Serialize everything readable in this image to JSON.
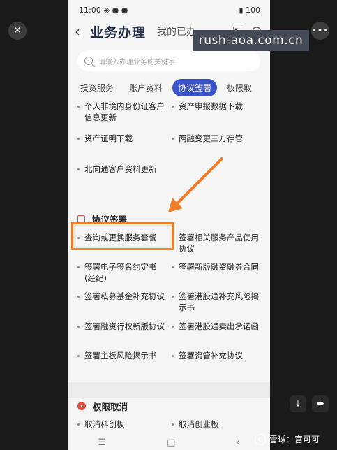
{
  "status": {
    "time": "11:00",
    "battery": "100"
  },
  "header": {
    "title": "业务办理",
    "my_tab": "我的已办"
  },
  "search": {
    "placeholder": "请输入办理业务的关键字"
  },
  "tabs": [
    "投资服务",
    "账户资料",
    "协议签署",
    "权限取"
  ],
  "active_tab_index": 2,
  "account_items": [
    [
      "个人非境内身份证客户信息更新",
      "资产申报数据下载"
    ],
    [
      "资产证明下载",
      "两融变更三方存管"
    ],
    [
      "北向通客户资料更新",
      ""
    ]
  ],
  "section_agreement": {
    "title": "协议签署",
    "items": [
      [
        "查询或更换服务套餐",
        "签署相关服务产品使用协议"
      ],
      [
        "签署电子签名约定书(经纪)",
        "签署新版融资融券合同"
      ],
      [
        "签署私募基金补充协议",
        "签署港股通补充风险揭示书"
      ],
      [
        "签署融资行权新版协议",
        "签署港股通卖出承诺函"
      ],
      [
        "签署主板风险揭示书",
        "签署资管补充协议"
      ]
    ]
  },
  "section_permission": {
    "title": "权限取消",
    "items": [
      [
        "取消科创板",
        "取消创业板"
      ]
    ]
  },
  "overlay": {
    "url_text": "rush-aoa.com.cn",
    "watermark": "雪球：宫可可",
    "more": "•••",
    "close": "✕"
  },
  "colors": {
    "accent": "#3b53c8",
    "highlight": "#f07d2a",
    "section_icon": "#e24a3b"
  }
}
